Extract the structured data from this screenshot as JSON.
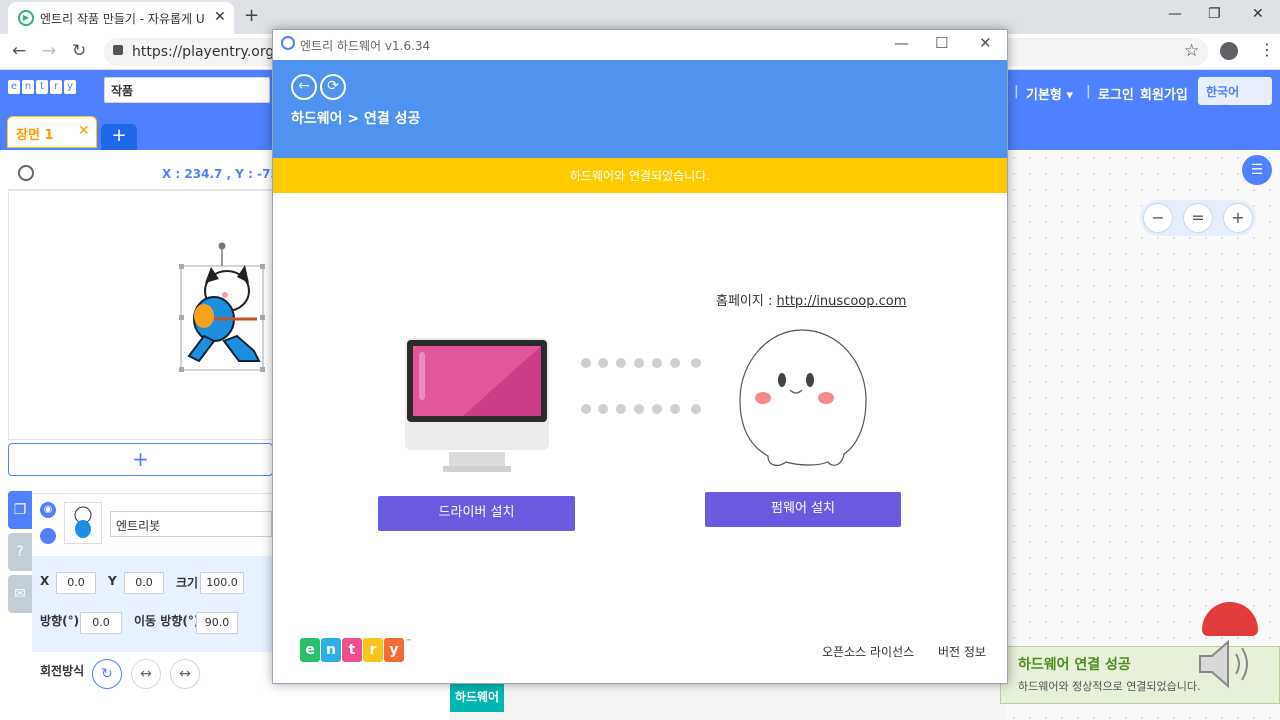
{
  "browser": {
    "tab_title": "엔트리 작품 만들기 - 자유롭게 U",
    "tab_close": "✕",
    "new_tab": "+",
    "url": "https://playentry.org/ws",
    "win_min": "—",
    "win_restore": "❐",
    "win_close": "✕",
    "back": "←",
    "forward": "→",
    "reload": "↻",
    "star": "☆"
  },
  "app": {
    "logo_letters": [
      "e",
      "n",
      "t",
      "r",
      "y"
    ],
    "project_name": "작품",
    "menu_basic": "기본형",
    "menu_basic_caret": "▾",
    "login": "로그인",
    "signup": "회원가입",
    "language": "한국어",
    "language_caret": "▾",
    "scene_label": "장면 1",
    "scene_close": "✕",
    "add_scene": "+",
    "coord_text": "X : 234.7 ,  Y : -75.6",
    "add_object": "+",
    "object_name": "엔트리봇",
    "props": {
      "x_label": "X",
      "x_value": "0.0",
      "y_label": "Y",
      "y_value": "0.0",
      "size_label": "크기",
      "size_value": "100.0",
      "direction_label": "방향(°)",
      "direction_value": "0.0",
      "move_dir_label": "이동 방향(°)",
      "move_dir_value": "90.0",
      "rotation_label": "회전방식"
    },
    "left_menu_help": "?",
    "hardware_tab": "하드웨어",
    "zoom_out": "−",
    "zoom_reset": "=",
    "zoom_in": "+",
    "toast_title": "하드웨어 연결 성공",
    "toast_message": "하드웨어와 정상적으로 연결되었습니다."
  },
  "dialog": {
    "title": "엔트리 하드웨어 v1.6.34",
    "min": "—",
    "max": "☐",
    "close": "✕",
    "back_icon": "←",
    "refresh_icon": "⟳",
    "breadcrumb": "하드웨어 > 연결 성공",
    "banner": "하드웨어와 연결되었습니다.",
    "homepage_label": "홈페이지 : ",
    "homepage_link": "http://inuscoop.com",
    "driver_button": "드라이버 설치",
    "firmware_button": "펌웨어 설치",
    "footer_logo_letters": [
      "e",
      "n",
      "t",
      "r",
      "y"
    ],
    "footer_logo_mark": "™",
    "oss_license": "오픈소스 라이선스",
    "version_info": "버전 정보"
  },
  "colors": {
    "entry_blue": "#4f80ff",
    "dialog_header": "#4f92f0",
    "banner_yellow": "#ffcb00",
    "button_purple": "#6a5ae0",
    "logo_tiles": [
      "#2bbf6a",
      "#2dafe6",
      "#f04e8f",
      "#ffc21a",
      "#f36b35"
    ]
  }
}
